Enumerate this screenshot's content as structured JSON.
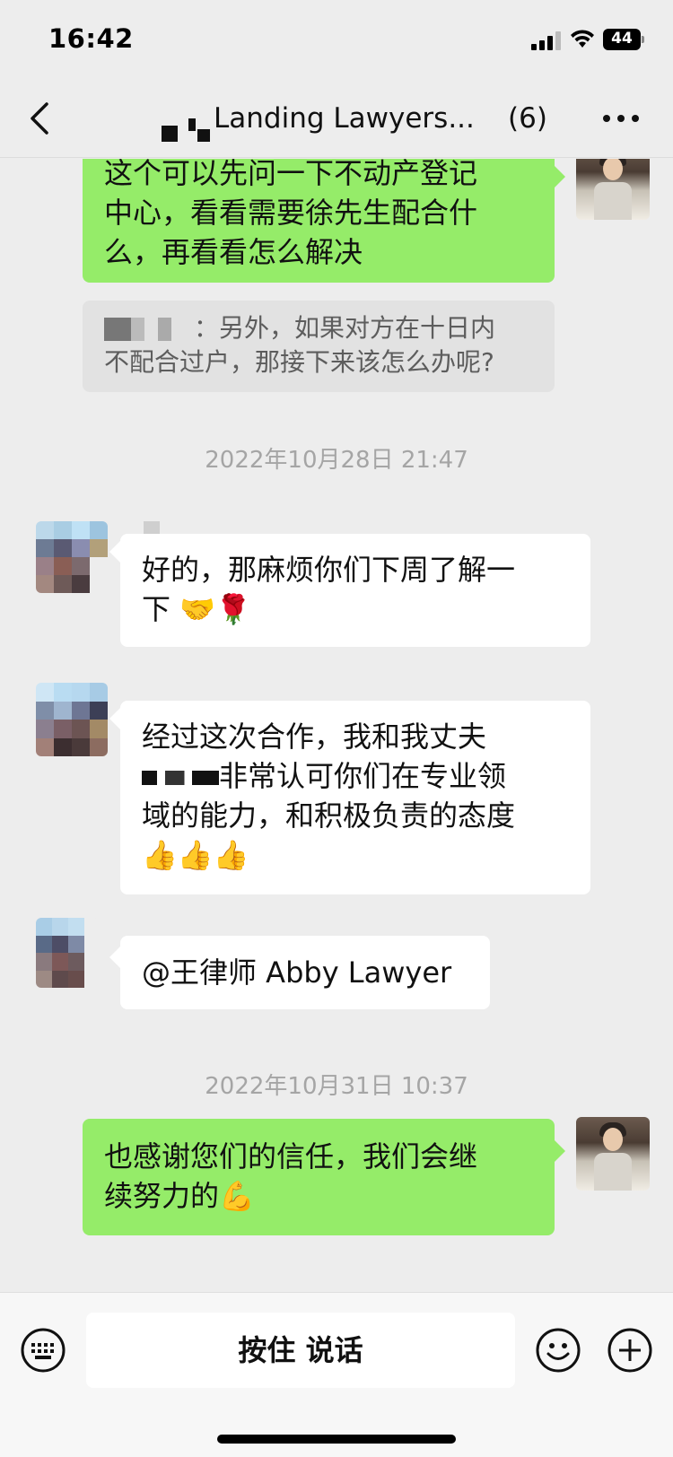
{
  "status_bar": {
    "time": "16:42",
    "battery": "44"
  },
  "nav": {
    "title": "Landing Lawyers...",
    "member_count": "(6)"
  },
  "messages": {
    "m1": {
      "lines": [
        "这个可以先问一下不动产登记",
        "中心，看看需要徐先生配合什",
        "么，再看看怎么解决"
      ]
    },
    "quote1": {
      "lines": [
        "：另外，如果对方在十日内",
        "不配合过户，那接下来该怎么办呢?"
      ]
    },
    "ts1": "2022年10月28日 21:47",
    "m2": {
      "lines": [
        "好的，那麻烦你们下周了解一",
        "下 🤝🌹"
      ]
    },
    "m3": {
      "lines": [
        "经过这次合作，我和我丈夫",
        "非常认可你们在专业领",
        "域的能力，和积极负责的态度",
        "👍👍👍"
      ]
    },
    "m4": {
      "lines": [
        "@王律师 Abby Lawyer"
      ]
    },
    "ts2": "2022年10月31日 10:37",
    "m5": {
      "lines": [
        "也感谢您们的信任，我们会继",
        "续努力的💪"
      ]
    }
  },
  "input_bar": {
    "voice_label": "按住 说话"
  },
  "icons": [
    "back-icon",
    "more-icon",
    "keyboard-icon",
    "emoji-icon",
    "plus-icon",
    "signal-icon",
    "wifi-icon",
    "battery-icon"
  ],
  "colors": {
    "bubble_self": "#95ec69",
    "bubble_other": "#ffffff",
    "background": "#ededed"
  }
}
